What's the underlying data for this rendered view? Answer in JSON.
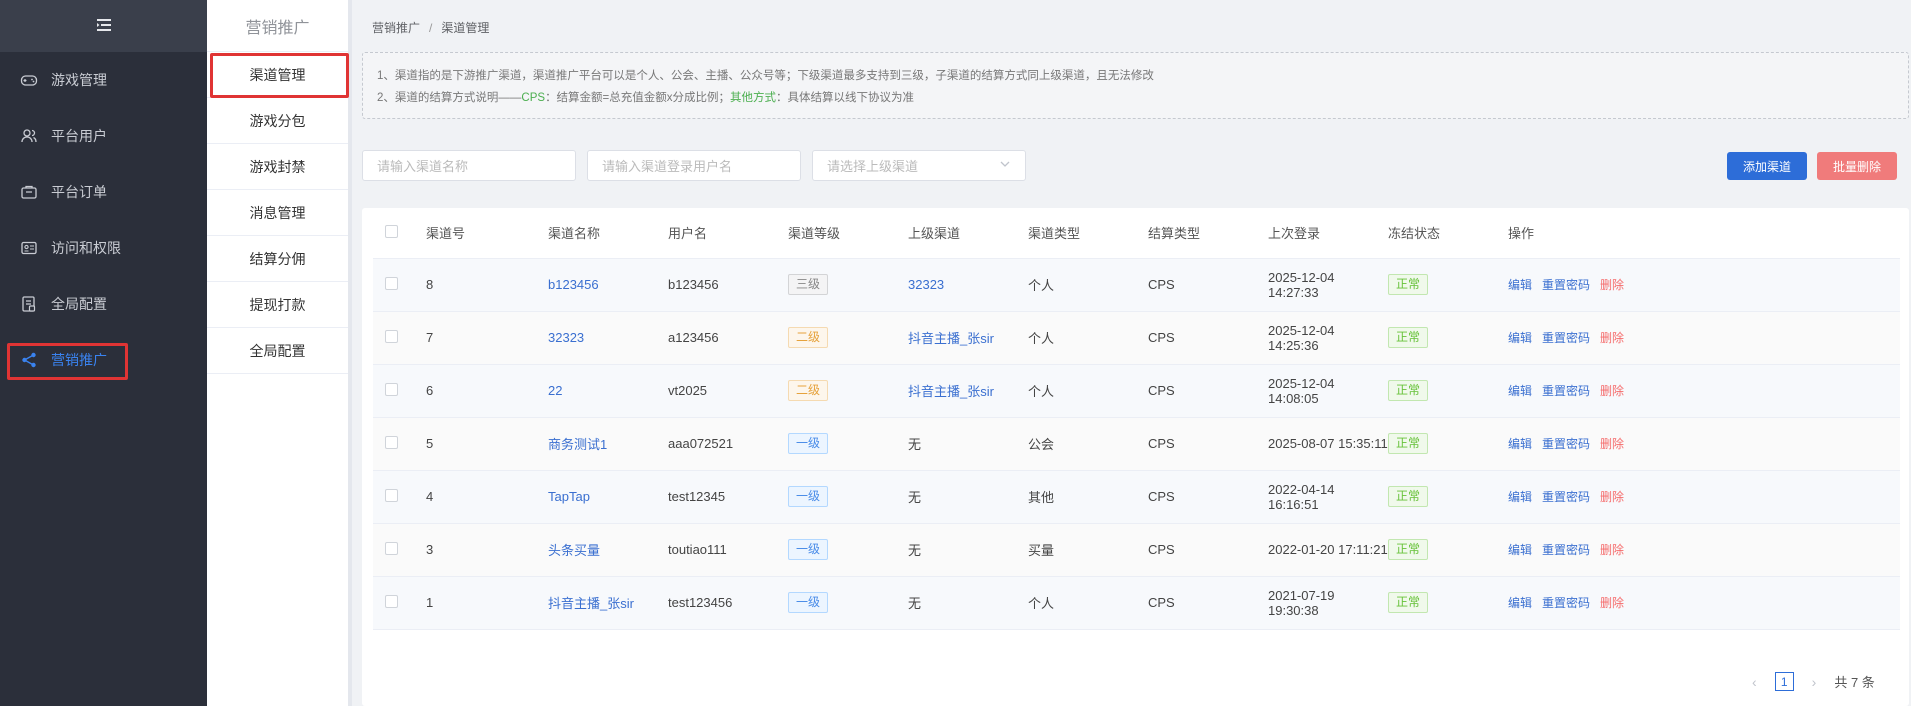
{
  "sidebar": {
    "items": [
      {
        "label": "游戏管理",
        "icon": "gamepad-icon"
      },
      {
        "label": "平台用户",
        "icon": "users-icon"
      },
      {
        "label": "平台订单",
        "icon": "order-icon"
      },
      {
        "label": "访问和权限",
        "icon": "access-icon"
      },
      {
        "label": "全局配置",
        "icon": "config-icon"
      },
      {
        "label": "营销推广",
        "icon": "share-icon"
      }
    ],
    "active_color": "#3a83f0"
  },
  "submenu": {
    "title": "营销推广",
    "items": [
      "渠道管理",
      "游戏分包",
      "游戏封禁",
      "消息管理",
      "结算分佣",
      "提现打款",
      "全局配置"
    ]
  },
  "breadcrumb": {
    "root": "营销推广",
    "sep": "/",
    "current": "渠道管理"
  },
  "notice": {
    "line1": "1、渠道指的是下游推广渠道，渠道推广平台可以是个人、公会、主播、公众号等；下级渠道最多支持到三级，子渠道的结算方式同上级渠道，且无法修改",
    "line2_prefix": "2、渠道的结算方式说明——",
    "line2_cps": "CPS",
    "line2_mid": "：结算金额=总充值金额x分成比例；",
    "line2_other": "其他方式",
    "line2_suffix": "：具体结算以线下协议为准"
  },
  "filters": {
    "name_placeholder": "请输入渠道名称",
    "user_placeholder": "请输入渠道登录用户名",
    "parent_placeholder": "请选择上级渠道"
  },
  "buttons": {
    "add": "添加渠道",
    "batch_delete": "批量删除"
  },
  "table": {
    "headers": [
      "渠道号",
      "渠道名称",
      "用户名",
      "渠道等级",
      "上级渠道",
      "渠道类型",
      "结算类型",
      "上次登录",
      "冻结状态",
      "操作"
    ],
    "op_labels": {
      "edit": "编辑",
      "reset": "重置密码",
      "delete": "删除"
    },
    "rows": [
      {
        "id": "8",
        "name": "b123456",
        "user": "b123456",
        "level": "三级",
        "level_cls": "l3",
        "parent": "32323",
        "parent_link": true,
        "type": "个人",
        "settle": "CPS",
        "last_login": "2025-12-04 14:27:33",
        "status": "正常"
      },
      {
        "id": "7",
        "name": "32323",
        "user": "a123456",
        "level": "二级",
        "level_cls": "l2",
        "parent": "抖音主播_张sir",
        "parent_link": true,
        "type": "个人",
        "settle": "CPS",
        "last_login": "2025-12-04 14:25:36",
        "status": "正常"
      },
      {
        "id": "6",
        "name": "22",
        "user": "vt2025",
        "level": "二级",
        "level_cls": "l2",
        "parent": "抖音主播_张sir",
        "parent_link": true,
        "type": "个人",
        "settle": "CPS",
        "last_login": "2025-12-04 14:08:05",
        "status": "正常"
      },
      {
        "id": "5",
        "name": "商务测试1",
        "user": "aaa072521",
        "level": "一级",
        "level_cls": "l1",
        "parent": "无",
        "parent_link": false,
        "type": "公会",
        "settle": "CPS",
        "last_login": "2025-08-07 15:35:11",
        "status": "正常"
      },
      {
        "id": "4",
        "name": "TapTap",
        "user": "test12345",
        "level": "一级",
        "level_cls": "l1",
        "parent": "无",
        "parent_link": false,
        "type": "其他",
        "settle": "CPS",
        "last_login": "2022-04-14 16:16:51",
        "status": "正常"
      },
      {
        "id": "3",
        "name": "头条买量",
        "user": "toutiao111",
        "level": "一级",
        "level_cls": "l1",
        "parent": "无",
        "parent_link": false,
        "type": "买量",
        "settle": "CPS",
        "last_login": "2022-01-20 17:11:21",
        "status": "正常"
      },
      {
        "id": "1",
        "name": "抖音主播_张sir",
        "user": "test123456",
        "level": "一级",
        "level_cls": "l1",
        "parent": "无",
        "parent_link": false,
        "type": "个人",
        "settle": "CPS",
        "last_login": "2021-07-19 19:30:38",
        "status": "正常"
      }
    ]
  },
  "pagination": {
    "prev": "‹",
    "current_page": "1",
    "next": "›",
    "total": "共 7 条"
  }
}
